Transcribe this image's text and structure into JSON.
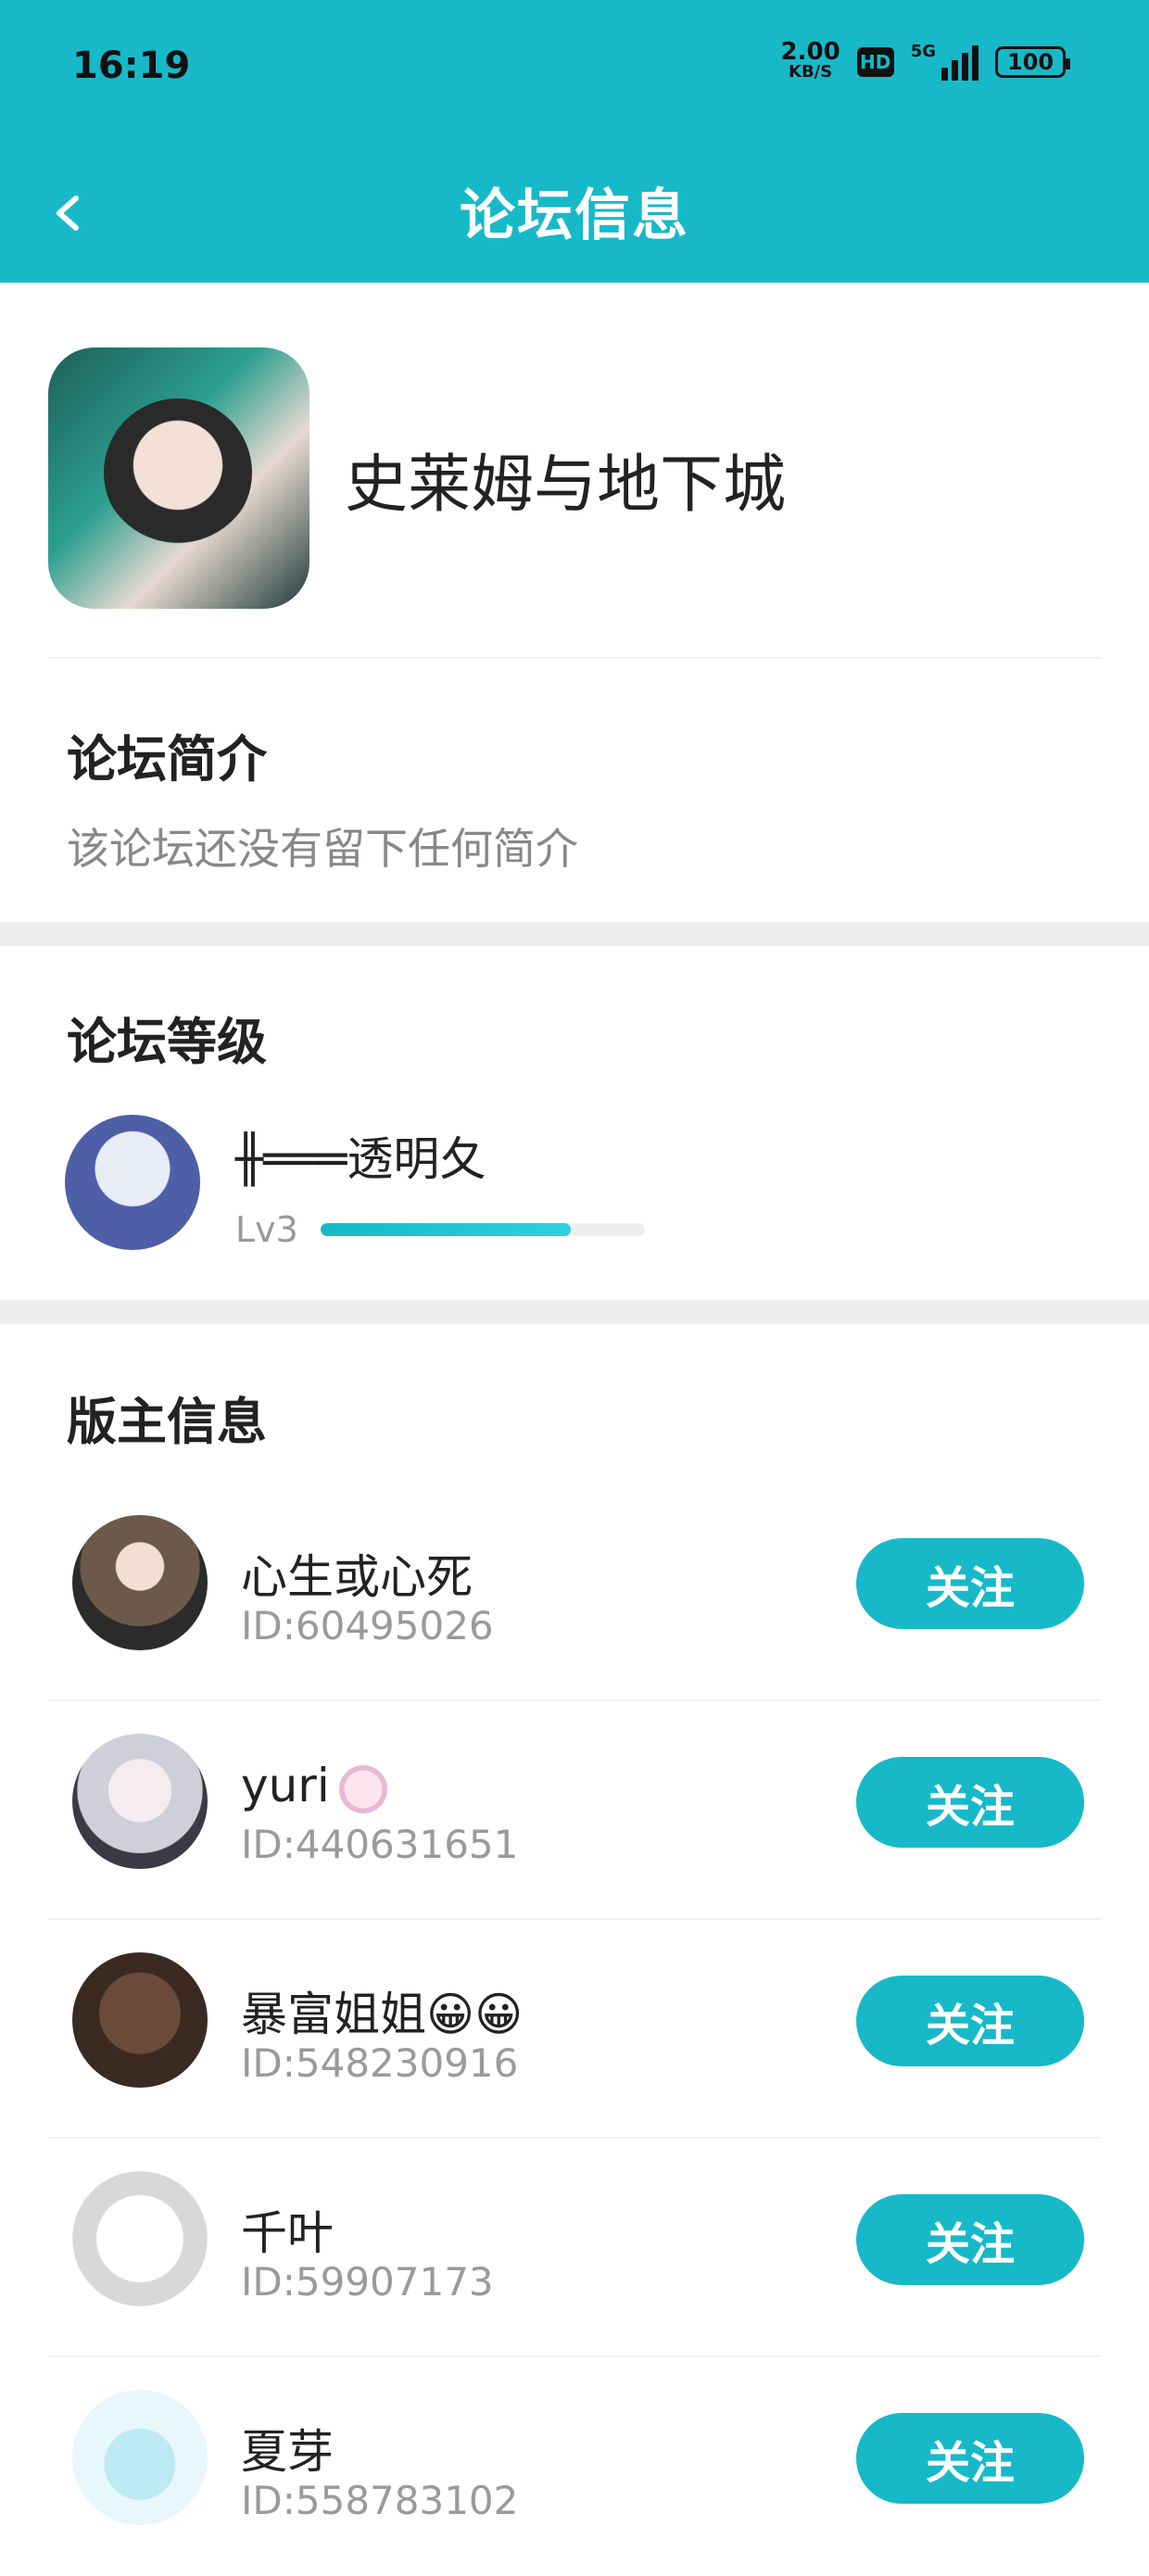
{
  "status_bar": {
    "time": "16:19",
    "net_speed_value": "2.00",
    "net_speed_unit": "KB/S",
    "hd_label": "HD",
    "network_label": "5G",
    "battery": "100"
  },
  "app_bar": {
    "title": "论坛信息",
    "back_icon": "chevron-left-icon"
  },
  "forum": {
    "name": "史莱姆与地下城",
    "intro_title": "论坛简介",
    "intro_text": "该论坛还没有留下任何简介"
  },
  "level_section": {
    "title": "论坛等级",
    "user_name": "╫═══透明夂",
    "level_label": "Lv3",
    "progress": 0.77
  },
  "moderators": {
    "title": "版主信息",
    "follow_label": "关注",
    "items": [
      {
        "name": "心生或心死",
        "id": "ID:60495026"
      },
      {
        "name": "yuri",
        "id": "ID:440631651"
      },
      {
        "name": "暴富姐姐😀😀",
        "id": "ID:548230916"
      },
      {
        "name": "千叶",
        "id": "ID:59907173"
      },
      {
        "name": "夏芽",
        "id": "ID:558783102"
      }
    ]
  },
  "colors": {
    "accent": "#17b9c8",
    "muted_text": "#9a9a9a",
    "divider": "#eeeeee"
  }
}
